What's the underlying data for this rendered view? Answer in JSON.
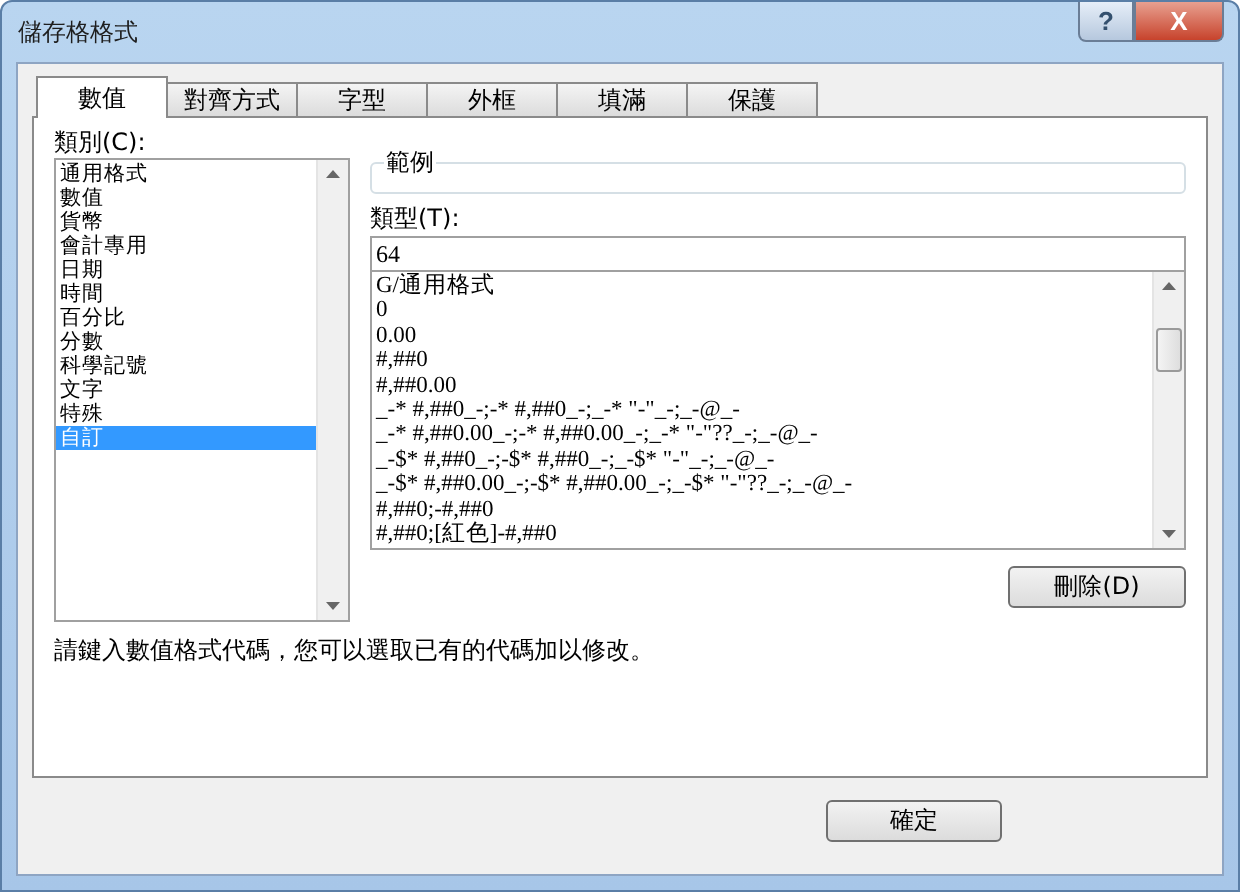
{
  "window": {
    "title": "儲存格格式",
    "buttons": [
      "?",
      "X"
    ]
  },
  "tabs": [
    {
      "label": "數值",
      "selected": true
    },
    {
      "label": "對齊方式",
      "selected": false
    },
    {
      "label": "字型",
      "selected": false
    },
    {
      "label": "外框",
      "selected": false
    },
    {
      "label": "填滿",
      "selected": false
    },
    {
      "label": "保護",
      "selected": false
    }
  ],
  "category": {
    "label": "類別(C):",
    "items": [
      {
        "label": "通用格式",
        "selected": false
      },
      {
        "label": "數值",
        "selected": false
      },
      {
        "label": "貨幣",
        "selected": false
      },
      {
        "label": "會計專用",
        "selected": false
      },
      {
        "label": "日期",
        "selected": false
      },
      {
        "label": "時間",
        "selected": false
      },
      {
        "label": "百分比",
        "selected": false
      },
      {
        "label": "分數",
        "selected": false
      },
      {
        "label": "科學記號",
        "selected": false
      },
      {
        "label": "文字",
        "selected": false
      },
      {
        "label": "特殊",
        "selected": false
      },
      {
        "label": "自訂",
        "selected": true
      }
    ]
  },
  "sample": {
    "label": "範例"
  },
  "type": {
    "label": "類型(T):",
    "value": "64",
    "formats": [
      "G/通用格式",
      "0",
      "0.00",
      "#,##0",
      "#,##0.00",
      "_-* #,##0_-;-* #,##0_-;_-* \"-\"_-;_-@_-",
      "_-* #,##0.00_-;-* #,##0.00_-;_-* \"-\"??_-;_-@_-",
      "_-$* #,##0_-;-$* #,##0_-;_-$* \"-\"_-;_-@_-",
      "_-$* #,##0.00_-;-$* #,##0.00_-;_-$* \"-\"??_-;_-@_-",
      "#,##0;-#,##0",
      "#,##0;[紅色]-#,##0"
    ]
  },
  "delete_button": "刪除(D)",
  "hint": "請鍵入數值格式代碼，您可以選取已有的代碼加以修改。",
  "ok_button": "確定"
}
